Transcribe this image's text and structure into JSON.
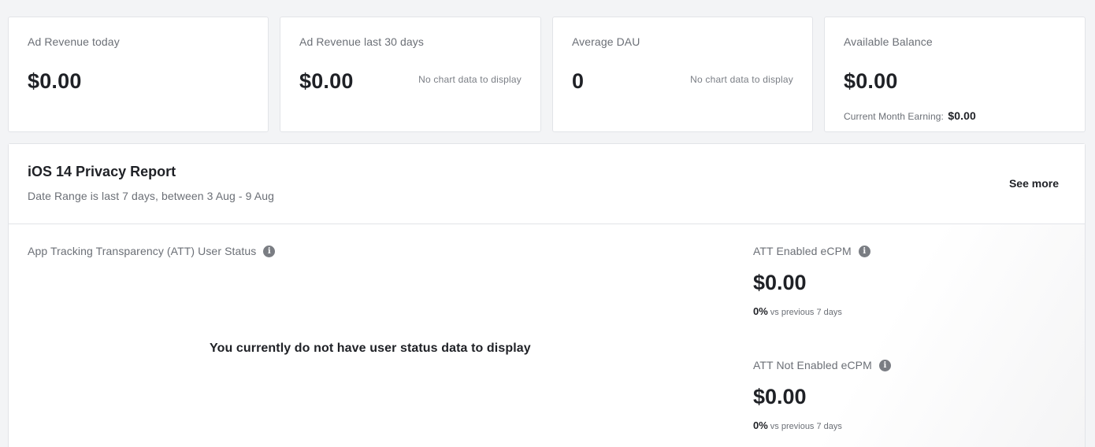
{
  "stats": [
    {
      "label": "Ad Revenue today",
      "value": "$0.00"
    },
    {
      "label": "Ad Revenue last 30 days",
      "value": "$0.00",
      "chart_message": "No chart data to display"
    },
    {
      "label": "Average DAU",
      "value": "0",
      "chart_message": "No chart data to display"
    },
    {
      "label": "Available Balance",
      "value": "$0.00",
      "sub_label": "Current Month Earning:",
      "sub_value": "$0.00"
    }
  ],
  "report": {
    "title": "iOS 14 Privacy Report",
    "date_range": "Date Range is last 7 days, between 3 Aug - 9 Aug",
    "see_more": "See more",
    "att_status": {
      "label": "App Tracking Transparency (ATT) User Status",
      "info_icon": "info-icon",
      "empty_message": "You currently do not have user status data to display"
    },
    "att_enabled": {
      "label": "ATT Enabled eCPM",
      "value": "$0.00",
      "change": "0%",
      "change_label": "vs previous 7 days"
    },
    "att_not_enabled": {
      "label": "ATT Not Enabled eCPM",
      "value": "$0.00",
      "change": "0%",
      "change_label": "vs previous 7 days"
    }
  },
  "colors": {
    "background": "#f3f4f6",
    "card": "#ffffff",
    "border": "#e2e4e8",
    "text_primary": "#1f2126",
    "text_secondary": "#6b6f76",
    "info_icon": "#7a7d83"
  }
}
